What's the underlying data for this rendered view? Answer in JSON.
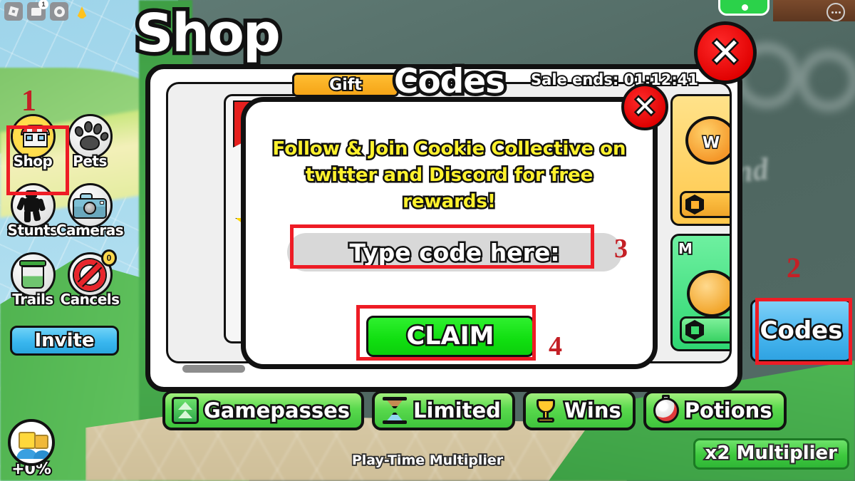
{
  "roblox_bar": {
    "items": [
      {
        "icon": "roblox-logo-icon",
        "label": ""
      },
      {
        "icon": "chat-icon",
        "label": "",
        "badge": "1"
      },
      {
        "icon": "gear-icon",
        "label": ""
      },
      {
        "icon": "bell-icon",
        "label": ""
      }
    ]
  },
  "sidebar": {
    "items": [
      {
        "label": "Shop",
        "icon": "shop-icon"
      },
      {
        "label": "Pets",
        "icon": "paw-icon"
      },
      {
        "label": "Stunts",
        "icon": "stunt-figure-icon"
      },
      {
        "label": "Cameras",
        "icon": "camera-icon"
      },
      {
        "label": "Trails",
        "icon": "paint-bucket-icon"
      },
      {
        "label": "Cancels",
        "icon": "no-entry-icon",
        "count": "0"
      }
    ],
    "invite_label": "Invite"
  },
  "friend_badge": {
    "value": "+0%",
    "icon": "friends-icon"
  },
  "hud": {
    "play_time_multiplier": "Play-Time Multiplier",
    "multiplier_badge": "x2 Multiplier",
    "codes_side_button": "Codes"
  },
  "shop": {
    "title": "Shop",
    "gift_label": "Gift",
    "sale_timer": "Sale ends: 01:12:41",
    "close_glyph": "✕",
    "items": [
      {
        "name": "item-left-card",
        "coin_text": ""
      },
      {
        "name": "item-right-top",
        "coin_text": "W",
        "price_icon": "robux-icon"
      },
      {
        "name": "item-right-bottom",
        "label": "M",
        "price_icon": "robux-icon"
      }
    ],
    "tabs": [
      {
        "label": "Gamepasses",
        "icon": "gamepass-arrow-icon"
      },
      {
        "label": "Limited",
        "icon": "hourglass-icon"
      },
      {
        "label": "Wins",
        "icon": "trophy-icon"
      },
      {
        "label": "Potions",
        "icon": "potion-icon"
      }
    ]
  },
  "codes_modal": {
    "title": "Codes",
    "description": "Follow & Join Cookie Collective on twitter and Discord for free rewards!",
    "input_placeholder": "Type code here:",
    "input_value": "",
    "claim_label": "CLAIM",
    "close_glyph": "✕"
  },
  "annotations": [
    {
      "number": "1",
      "target": "shop-sidebar-button"
    },
    {
      "number": "2",
      "target": "codes-side-button"
    },
    {
      "number": "3",
      "target": "code-input"
    },
    {
      "number": "4",
      "target": "claim-button"
    }
  ],
  "colors": {
    "annotation_red": "#ee1c25",
    "annotation_number": "#c42026",
    "claim_green": "#10de10",
    "codes_blue": "#49b6ef",
    "desc_yellow": "#fff22e",
    "gift_orange": "#f5a417",
    "tab_green": "#59d94d"
  },
  "background_text": {
    "wall_word": "and"
  }
}
